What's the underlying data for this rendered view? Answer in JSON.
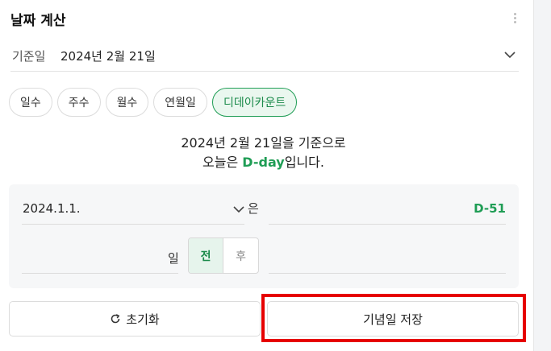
{
  "widget": {
    "title": "날짜 계산"
  },
  "base": {
    "label": "기준일",
    "value": "2024년 2월 21일"
  },
  "tabs": [
    {
      "label": "일수",
      "active": false
    },
    {
      "label": "주수",
      "active": false
    },
    {
      "label": "월수",
      "active": false
    },
    {
      "label": "연월일",
      "active": false
    },
    {
      "label": "디데이카운트",
      "active": true
    }
  ],
  "message": {
    "line1": "2024년 2월 21일을 기준으로",
    "line2_prefix": "오늘은 ",
    "line2_highlight": "D-day",
    "line2_suffix": "입니다."
  },
  "calc": {
    "date_value": "2024.1.1.",
    "connector": "은",
    "result": "D-51",
    "day_unit": "일",
    "before_label": "전",
    "after_label": "후",
    "selected": "전"
  },
  "buttons": {
    "reset_label": "초기화",
    "save_label": "기념일 저장"
  },
  "colors": {
    "accent": "#1f9d55",
    "highlight_box": "#e60000"
  },
  "icons": {
    "menu": "more-vertical-icon",
    "chevron": "chevron-down-icon",
    "reset": "refresh-icon"
  }
}
